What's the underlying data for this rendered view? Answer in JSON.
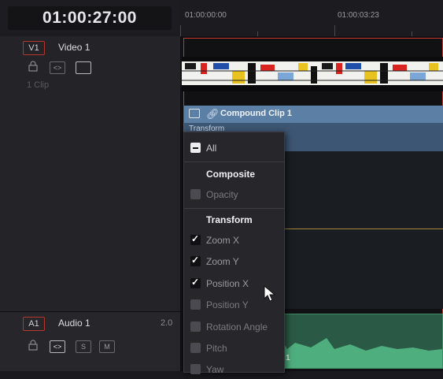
{
  "header": {
    "timecode": "01:00:27:00",
    "ruler_labels": [
      "01:00:00:00",
      "01:00:03:23"
    ]
  },
  "video_track": {
    "id": "V1",
    "name": "Video 1",
    "clip_count": "1 Clip",
    "icons": [
      "lock-icon",
      "auto-select-icon",
      "enable-track-icon"
    ]
  },
  "compound_clip": {
    "title": "Compound Clip 1",
    "sub_label": "Transform",
    "icons": [
      "film-icon",
      "link-icon"
    ]
  },
  "audio_track": {
    "id": "A1",
    "name": "Audio 1",
    "channels": "2.0",
    "solo_label": "S",
    "mute_label": "M",
    "clip_label": "1"
  },
  "dropdown": {
    "all_label": "All",
    "composite_header": "Composite",
    "opacity_label": "Opacity",
    "transform_header": "Transform",
    "items": [
      {
        "label": "Zoom X",
        "checked": true
      },
      {
        "label": "Zoom Y",
        "checked": true
      },
      {
        "label": "Position X",
        "checked": true
      },
      {
        "label": "Position Y",
        "checked": false
      },
      {
        "label": "Rotation Angle",
        "checked": false
      },
      {
        "label": "Pitch",
        "checked": false
      },
      {
        "label": "Yaw",
        "checked": false
      }
    ]
  },
  "colors": {
    "track_id_border": "#b3372e",
    "compound_blue": "#5c7fa6",
    "audio_green": "#2a5a45",
    "clip_outline": "#c8382e"
  }
}
